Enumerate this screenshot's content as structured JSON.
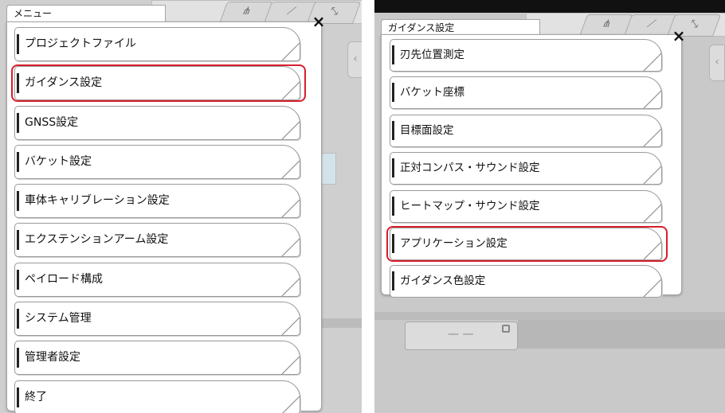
{
  "left": {
    "panel_title": "メニュー",
    "close_label": "×",
    "items": [
      {
        "label": "プロジェクトファイル"
      },
      {
        "label": "ガイダンス設定"
      },
      {
        "label": "GNSS設定"
      },
      {
        "label": "バケット設定"
      },
      {
        "label": "車体キャリブレーション設定"
      },
      {
        "label": "エクステンションアーム設定"
      },
      {
        "label": "ペイロード構成"
      },
      {
        "label": "システム管理"
      },
      {
        "label": "管理者設定"
      },
      {
        "label": "終了"
      }
    ],
    "highlighted_item": "ガイダンス設定"
  },
  "right": {
    "panel_title": "ガイダンス設定",
    "close_label": "×",
    "items": [
      {
        "label": "刃先位置測定"
      },
      {
        "label": "バケット座標"
      },
      {
        "label": "目標面設定"
      },
      {
        "label": "正対コンパス・サウンド設定"
      },
      {
        "label": "ヒートマップ・サウンド設定"
      },
      {
        "label": "アプリケーション設定"
      },
      {
        "label": "ガイダンス色設定"
      }
    ],
    "highlighted_item": "アプリケーション設定"
  },
  "colors": {
    "highlight": "#d61f2c",
    "panel_background": "#ffffff",
    "screen_background": "#cfcfcf"
  }
}
